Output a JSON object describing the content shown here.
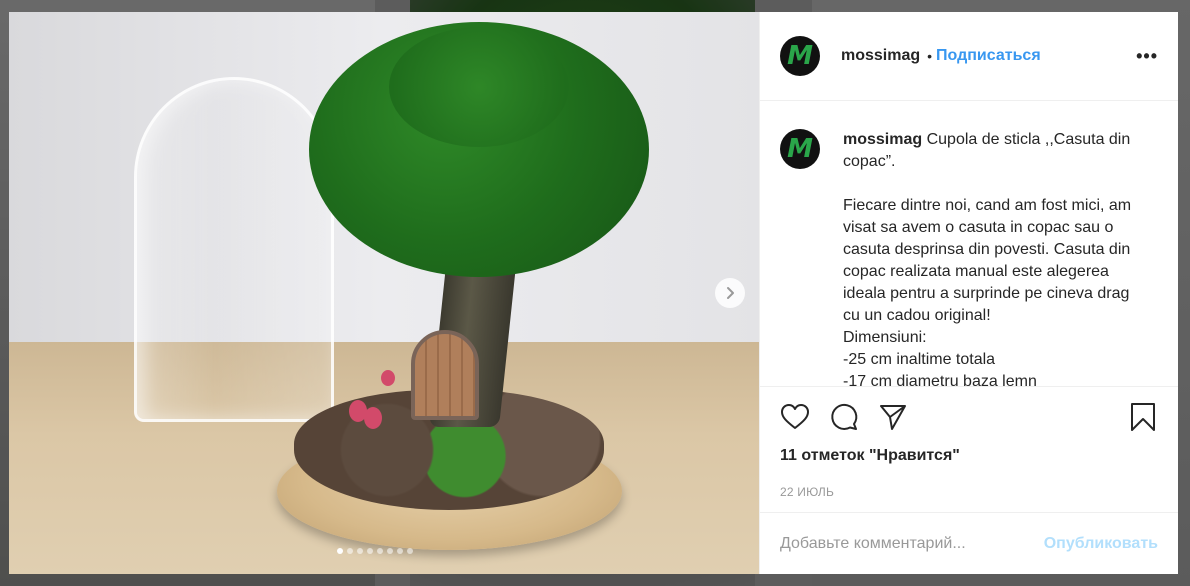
{
  "post": {
    "username": "mossimag",
    "follow_separator": "•",
    "follow_label": "Подписаться",
    "more_label": "•••",
    "avatar_letter": "M",
    "caption_user": "mossimag",
    "caption_text": " Cupola de sticla ,,Casuta din copac”.\n\nFiecare dintre noi, cand am fost mici, am visat sa avem o casuta in copac sau o casuta desprinsa din povesti. Casuta din copac realizata manual este alegerea ideala pentru a surprinde pe cineva drag cu un cadou original!\nDimensiuni:\n-25 cm inaltime totala\n-17 cm diametru baza lemn",
    "likes": "11 отметок \"Нравится\"",
    "date": "22 июль",
    "carousel": {
      "count": 8,
      "active_index": 0
    }
  },
  "comment": {
    "placeholder": "Добавьте комментарий...",
    "publish_label": "Опубликовать"
  },
  "icons": {
    "like": "heart-icon",
    "comment": "comment-icon",
    "share": "share-icon",
    "save": "bookmark-icon",
    "next": "chevron-right-icon"
  },
  "colors": {
    "link": "#3897f0",
    "publish_disabled": "#b2dffc",
    "avatar_letter": "#2aa64a"
  }
}
